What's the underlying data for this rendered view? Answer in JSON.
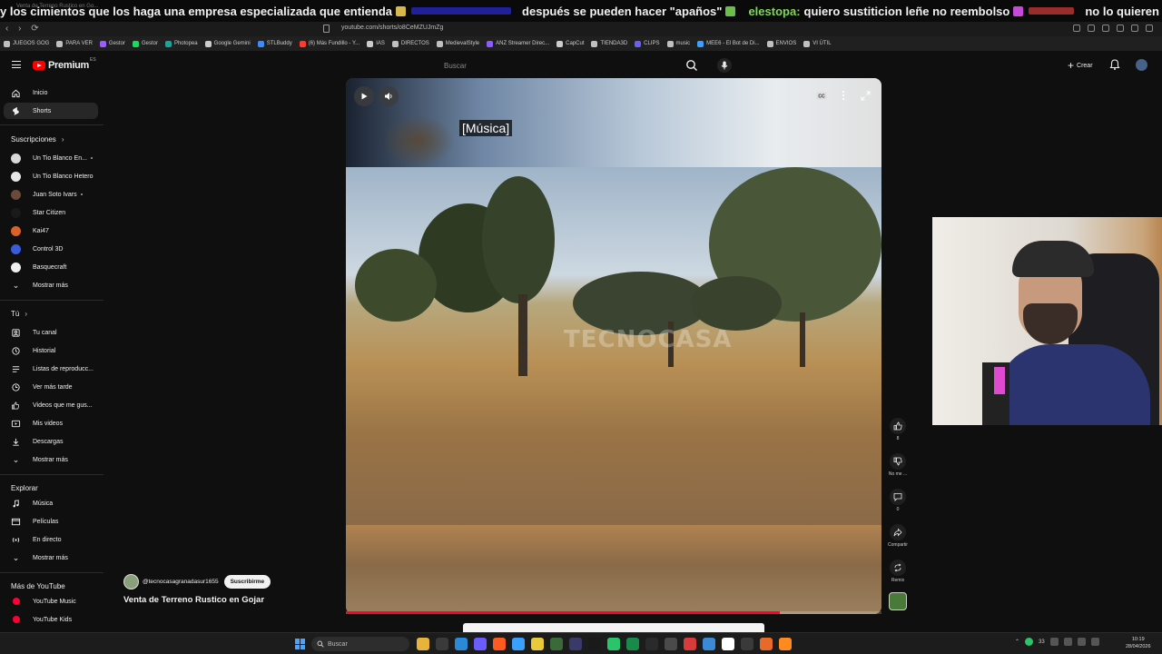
{
  "chat": {
    "tab_hint": "Venta de Terreno Rustico en Go...",
    "messages": [
      {
        "user": "",
        "text": "y los cimientos que los haga una empresa especializada que entienda",
        "emote_color": "#d9b84a",
        "user_color": "#ffffff"
      },
      {
        "user": "",
        "text": "después se pueden hacer \"apaños\"",
        "emote_color": "#4aa3d9",
        "user_color": "#3b3bd9"
      },
      {
        "user": "elestopa:",
        "text": "quiero sustiticion leñe no reembolso",
        "emote_color": "#6abf4b",
        "user_color": "#7ed957"
      },
      {
        "user": "",
        "text": "no lo quieren dar uno nuevo entiendo",
        "emote_color": "#c64ad9",
        "user_color": "#d93b3b"
      }
    ]
  },
  "browser": {
    "url": "youtube.com/shorts/o8CeMZUJmZg"
  },
  "bookmarks": [
    {
      "label": "JUEGOS GOG",
      "color": "#c0c0c0"
    },
    {
      "label": "PARA VER",
      "color": "#c0c0c0"
    },
    {
      "label": "Gestor",
      "color": "#9d5cff"
    },
    {
      "label": "Gestor",
      "color": "#1ed760"
    },
    {
      "label": "Photopea",
      "color": "#1ea39b"
    },
    {
      "label": "Google Gemini",
      "color": "#cccccc"
    },
    {
      "label": "STLBuddy",
      "color": "#3c8cff"
    },
    {
      "label": "(6) Más Fundillo - Y...",
      "color": "#ff3b30"
    },
    {
      "label": "IAS",
      "color": "#cccccc"
    },
    {
      "label": "DIRECTOS",
      "color": "#c0c0c0"
    },
    {
      "label": "MedievalStyle",
      "color": "#c0c0c0"
    },
    {
      "label": "ANZ Streamer Direc...",
      "color": "#8a5cff"
    },
    {
      "label": "CapCut",
      "color": "#cccccc"
    },
    {
      "label": "TIENDA3D",
      "color": "#c0c0c0"
    },
    {
      "label": "CLIPS",
      "color": "#6a5cff"
    },
    {
      "label": "music",
      "color": "#c0c0c0"
    },
    {
      "label": "MEE6 - El Bot de Di...",
      "color": "#3ca0ff"
    },
    {
      "label": "ENVIOS",
      "color": "#c0c0c0"
    },
    {
      "label": "VI ÚTIL",
      "color": "#c0c0c0"
    }
  ],
  "header": {
    "brand": "Premium",
    "brand_sup": "ES",
    "search_placeholder": "Buscar",
    "create_label": "Crear"
  },
  "sidebar": {
    "main": [
      {
        "label": "Inicio",
        "icon": "home-icon",
        "active": false
      },
      {
        "label": "Shorts",
        "icon": "shorts-icon",
        "active": true
      }
    ],
    "subs_title": "Suscripciones",
    "subs": [
      {
        "label": "Un Tio Blanco En...",
        "color": "#d8d8d8",
        "live": true
      },
      {
        "label": "Un Tio Blanco Hetero",
        "color": "#e8e8e8",
        "live": false
      },
      {
        "label": "Juan Soto Ivars",
        "color": "#6a4a3a",
        "live": true
      },
      {
        "label": "Star Citizen",
        "color": "#1a1a1a",
        "live": false
      },
      {
        "label": "Kai47",
        "color": "#d9622b",
        "live": false
      },
      {
        "label": "Control 3D",
        "color": "#3b5bd9",
        "live": false
      },
      {
        "label": "Basquecraft",
        "color": "#f0f0f0",
        "live": false
      }
    ],
    "subs_more": "Mostrar más",
    "you_title": "Tú",
    "you": [
      {
        "label": "Tu canal",
        "icon": "channel-icon"
      },
      {
        "label": "Historial",
        "icon": "history-icon"
      },
      {
        "label": "Listas de reproducc...",
        "icon": "playlist-icon"
      },
      {
        "label": "Ver más tarde",
        "icon": "clock-icon"
      },
      {
        "label": "Videos que me gus...",
        "icon": "like-icon"
      },
      {
        "label": "Mis videos",
        "icon": "my-videos-icon"
      },
      {
        "label": "Descargas",
        "icon": "download-icon"
      }
    ],
    "you_more": "Mostrar más",
    "explore_title": "Explorar",
    "explore": [
      {
        "label": "Música",
        "icon": "music-icon"
      },
      {
        "label": "Películas",
        "icon": "movies-icon"
      },
      {
        "label": "En directo",
        "icon": "live-icon"
      }
    ],
    "explore_more": "Mostrar más",
    "more_title": "Más de YouTube",
    "more": [
      {
        "label": "YouTube Music",
        "color": "#ff0033"
      },
      {
        "label": "YouTube Kids",
        "color": "#ff0033"
      }
    ]
  },
  "video": {
    "caption": "[Música]",
    "watermark": "TECNOCASA",
    "progress": 0.81,
    "channel": "@tecnocasagranadasur1655",
    "subscribe_label": "Suscribirme",
    "title": "Venta de Terreno Rustico en Gojar"
  },
  "actions": {
    "like_count": "8",
    "dislike_label": "No me ...",
    "comments_count": "0",
    "share_label": "Compartir",
    "remix_label": "Remix"
  },
  "taskbar": {
    "search_placeholder": "Buscar",
    "tray_count": "33",
    "time": "10:19",
    "date": "28/04/2026",
    "app_colors": [
      "#e8b33a",
      "#3a3a3a",
      "#2a8ad8",
      "#6a5cff",
      "#ff5a1f",
      "#3aa0ff",
      "#e8c93a",
      "#3a6a3a",
      "#3a3a6a",
      "#1a1a1a",
      "#2ac46a",
      "#1a8a4a",
      "#2a2a2a",
      "#4a4a4a",
      "#d93b3b",
      "#3a8ad8",
      "#ffffff",
      "#3a3a3a",
      "#e86a2a",
      "#ff8a1f"
    ]
  }
}
